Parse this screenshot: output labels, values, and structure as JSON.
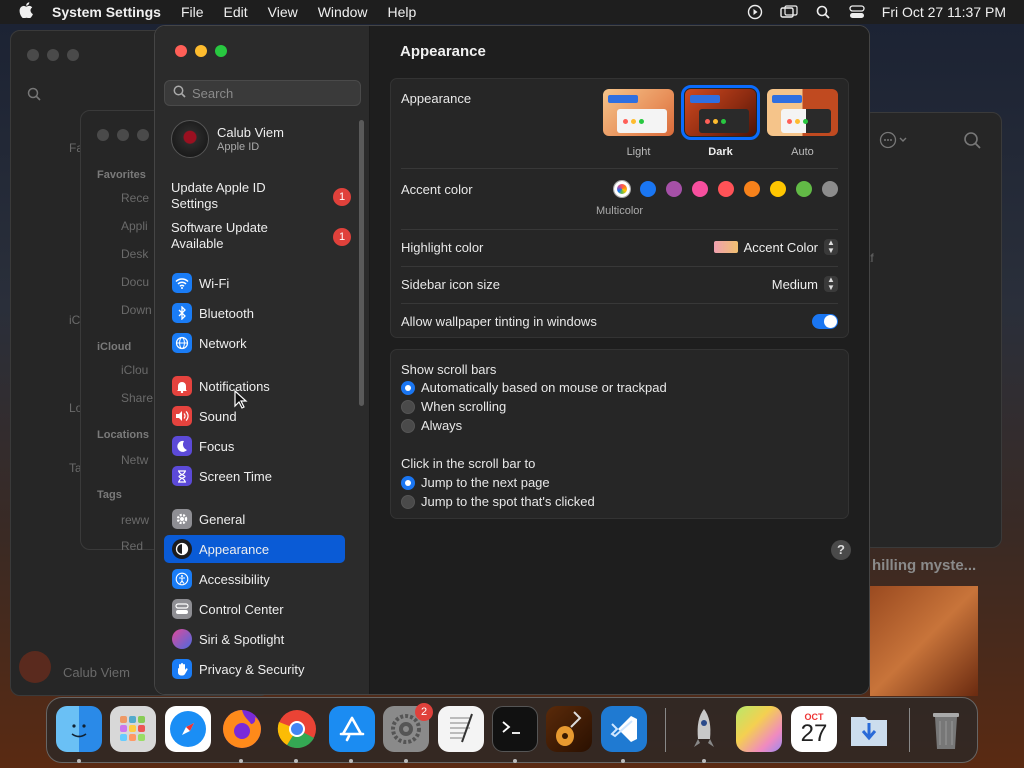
{
  "menubar": {
    "app_name": "System Settings",
    "menus": [
      "File",
      "Edit",
      "View",
      "Window",
      "Help"
    ],
    "clock": "Fri Oct 27  11:37 PM"
  },
  "background": {
    "finder_sections": [
      "Favorites",
      "iCloud",
      "Locations",
      "Tags"
    ],
    "finder_items": [
      "Rece",
      "Appli",
      "Desk",
      "Docu",
      "Down",
      "iClou",
      "Share",
      "Netw",
      "reww",
      "Red"
    ],
    "side_letters": [
      "Fa",
      "iC",
      "Lo",
      "Ta"
    ],
    "user_label": "Calub Viem",
    "video_caption": "hilling myste...",
    "file_suffix": "tf"
  },
  "sidebar": {
    "search_placeholder": "Search",
    "account": {
      "name": "Calub Viem",
      "sub": "Apple ID"
    },
    "notices": [
      {
        "label": "Update Apple ID Settings",
        "badge": "1"
      },
      {
        "label": "Software Update Available",
        "badge": "1"
      }
    ],
    "items": [
      {
        "label": "Wi-Fi",
        "icon": "wifi-icon",
        "color": "#1a7cf5"
      },
      {
        "label": "Bluetooth",
        "icon": "bluetooth-icon",
        "color": "#1a7cf5"
      },
      {
        "label": "Network",
        "icon": "globe-icon",
        "color": "#1a7cf5"
      },
      {
        "label": "Notifications",
        "icon": "bell-icon",
        "color": "#e5433e"
      },
      {
        "label": "Sound",
        "icon": "speaker-icon",
        "color": "#e5433e"
      },
      {
        "label": "Focus",
        "icon": "moon-icon",
        "color": "#5c4ad8"
      },
      {
        "label": "Screen Time",
        "icon": "hourglass-icon",
        "color": "#5c4ad8"
      },
      {
        "label": "General",
        "icon": "gear-icon",
        "color": "#8e8e93"
      },
      {
        "label": "Appearance",
        "icon": "appearance-icon",
        "color": "#1c1c1e"
      },
      {
        "label": "Accessibility",
        "icon": "accessibility-icon",
        "color": "#1a7cf5"
      },
      {
        "label": "Control Center",
        "icon": "control-center-icon",
        "color": "#8e8e93"
      },
      {
        "label": "Siri & Spotlight",
        "icon": "siri-icon",
        "color": "#b03ad6"
      },
      {
        "label": "Privacy & Security",
        "icon": "hand-icon",
        "color": "#1a7cf5"
      }
    ],
    "active_item": "Appearance"
  },
  "content": {
    "title": "Appearance",
    "appearance": {
      "label": "Appearance",
      "options": [
        {
          "label": "Light",
          "selected": false
        },
        {
          "label": "Dark",
          "selected": true
        },
        {
          "label": "Auto",
          "selected": false
        }
      ]
    },
    "accent": {
      "label": "Accent color",
      "selected_label": "Multicolor",
      "colors": [
        "#1a76f2",
        "#a550a7",
        "#f74f9e",
        "#ff5257",
        "#f7821b",
        "#ffc600",
        "#62ba46",
        "#8c8c8c"
      ]
    },
    "highlight": {
      "label": "Highlight color",
      "value": "Accent Color"
    },
    "sidebar_icon_size": {
      "label": "Sidebar icon size",
      "value": "Medium"
    },
    "wallpaper_tinting": {
      "label": "Allow wallpaper tinting in windows",
      "on": true
    },
    "scroll_bars": {
      "label": "Show scroll bars",
      "options": [
        {
          "label": "Automatically based on mouse or trackpad",
          "selected": true
        },
        {
          "label": "When scrolling",
          "selected": false
        },
        {
          "label": "Always",
          "selected": false
        }
      ]
    },
    "click_scroll": {
      "label": "Click in the scroll bar to",
      "options": [
        {
          "label": "Jump to the next page",
          "selected": true
        },
        {
          "label": "Jump to the spot that's clicked",
          "selected": false
        }
      ]
    },
    "help": "?"
  },
  "dock": {
    "settings_badge": "2",
    "calendar_month": "OCT",
    "calendar_day": "27"
  }
}
